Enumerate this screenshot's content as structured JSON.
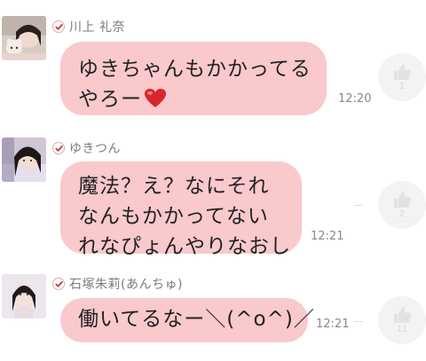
{
  "messages": [
    {
      "sender": "川上 礼奈",
      "lines": [
        "ゆきちゃんもかかってる",
        "やろー"
      ],
      "emoji": "heart",
      "time": "12:20",
      "likes": "1"
    },
    {
      "sender": "ゆきつん",
      "lines": [
        "魔法？え？なにそれ",
        "なんもかかってない",
        "れなぴょんやりなおし"
      ],
      "time": "12:21",
      "likes": "2"
    },
    {
      "sender": "石塚朱莉(あんちゅ)",
      "lines": [
        "働いてるなー＼(^o^)／"
      ],
      "time": "12:21",
      "likes": "11"
    }
  ],
  "colors": {
    "bubble": "#f9c9cc",
    "check": "#c9343e",
    "like_icon": "#e2e2e2"
  },
  "icons": {
    "verified": "check-badge-icon",
    "like": "thumbs-up-icon",
    "emoji": "red-heart-icon"
  }
}
